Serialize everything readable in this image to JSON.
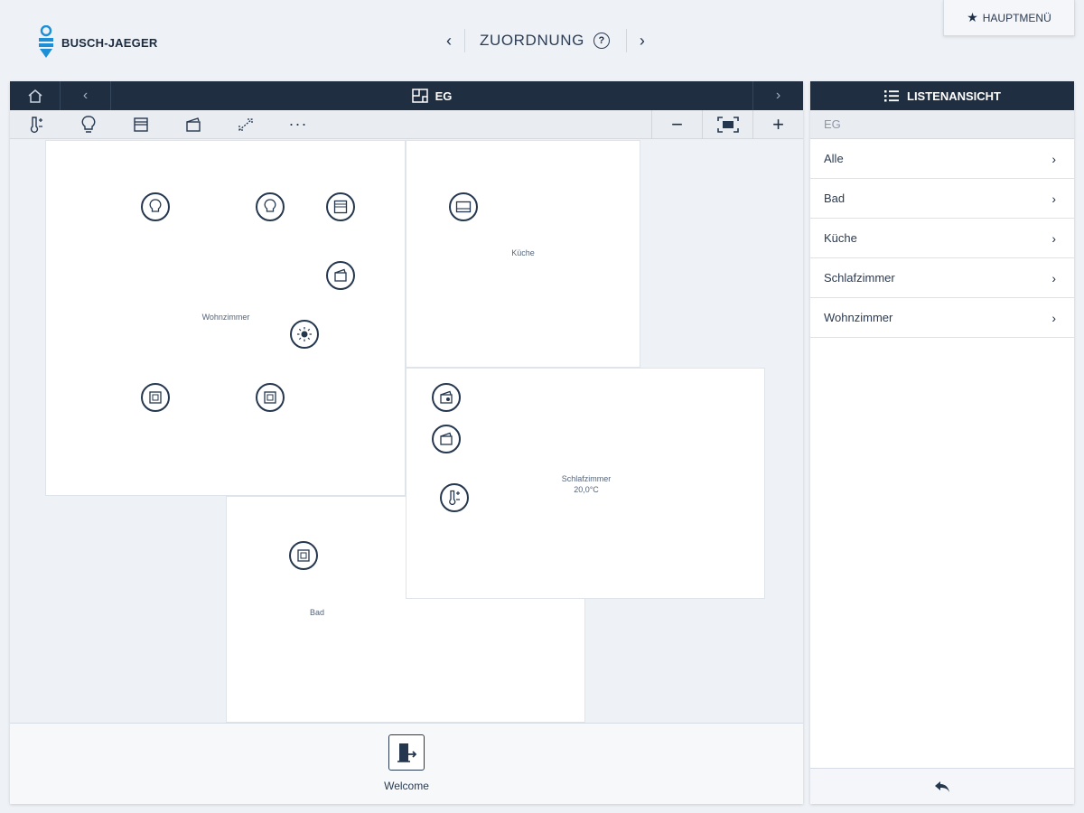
{
  "brand": {
    "name": "BUSCH-JAEGER"
  },
  "top_nav": {
    "prev": "‹",
    "title": "ZUORDNUNG",
    "help": "?",
    "next": "›"
  },
  "main_menu": {
    "label": "HAUPTMENÜ"
  },
  "plan": {
    "header_title": "EG",
    "back": "‹",
    "forward": "›",
    "toolbar": [
      "thermostat-tool",
      "light-tool",
      "blind-tool",
      "scene-tool",
      "shutter-tool",
      "more-tool"
    ],
    "zoom_out": "−",
    "zoom_in": "+",
    "rooms": {
      "wohnzimmer": "Wohnzimmer",
      "kueche": "Küche",
      "schlafzimmer": "Schlafzimmer",
      "schlafzimmer_temp": "20,0°C",
      "bad": "Bad"
    },
    "footer": {
      "welcome_label": "Welcome"
    }
  },
  "list_view": {
    "title": "LISTENANSICHT",
    "breadcrumb": "EG",
    "items": [
      {
        "label": "Alle"
      },
      {
        "label": "Bad"
      },
      {
        "label": "Küche"
      },
      {
        "label": "Schlafzimmer"
      },
      {
        "label": "Wohnzimmer"
      }
    ]
  },
  "colors": {
    "header_dark": "#1f2e41",
    "accent_blue": "#1c8fd6",
    "icon_dark": "#25374e"
  }
}
